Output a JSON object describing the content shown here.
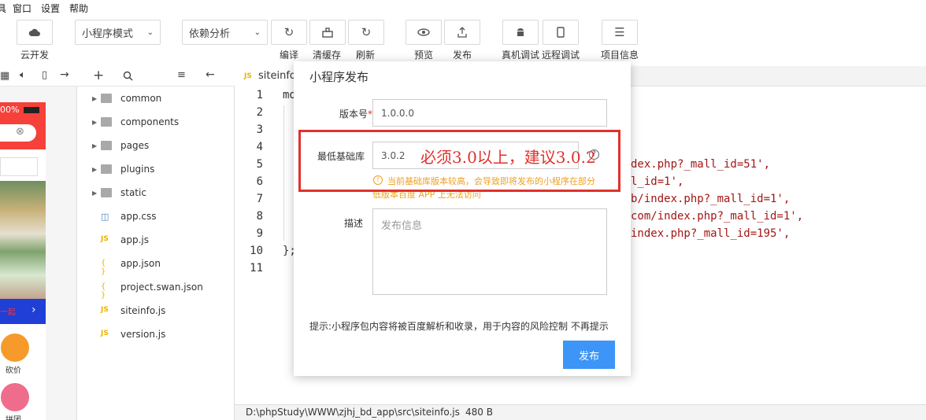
{
  "menubar": {
    "items": [
      "具",
      "窗口",
      "设置",
      "帮助"
    ]
  },
  "toolbar": {
    "cloud_label": "云开发",
    "mode_select": "小程序模式",
    "dep_select": "依赖分析",
    "compile_label": "编译",
    "clear_cache_label": "清缓存",
    "refresh_label": "刷新",
    "preview_label": "预览",
    "publish_label": "发布",
    "device_debug_label": "真机调试",
    "remote_debug_label": "远程调试",
    "project_info_label": "项目信息"
  },
  "simulator": {
    "battery_text": "00%",
    "side_labels": [
      "砍价",
      "拼团"
    ],
    "banner_text": "一起"
  },
  "file_tree": [
    {
      "name": "common",
      "type": "folder"
    },
    {
      "name": "components",
      "type": "folder"
    },
    {
      "name": "pages",
      "type": "folder"
    },
    {
      "name": "plugins",
      "type": "folder"
    },
    {
      "name": "static",
      "type": "folder"
    },
    {
      "name": "app.css",
      "type": "css"
    },
    {
      "name": "app.js",
      "type": "js"
    },
    {
      "name": "app.json",
      "type": "json"
    },
    {
      "name": "project.swan.json",
      "type": "json"
    },
    {
      "name": "siteinfo.js",
      "type": "js"
    },
    {
      "name": "version.js",
      "type": "js"
    }
  ],
  "editor": {
    "tab_title": "siteinfo.",
    "tab_icon": "JS",
    "line_numbers": [
      "1",
      "2",
      "3",
      "4",
      "5",
      "6",
      "7",
      "8",
      "9",
      "10",
      "11"
    ],
    "line1": "mo",
    "line5": "dex.php?_mall_id=51',",
    "line6": "l_id=1',",
    "line7": "b/index.php?_mall_id=1',",
    "line8": "com/index.php?_mall_id=1',",
    "line9": "index.php?_mall_id=195',",
    "line10": "};"
  },
  "statusbar": {
    "path": "D:\\phpStudy\\WWW\\zjhj_bd_app\\src\\siteinfo.js",
    "size": "480 B"
  },
  "dialog": {
    "title": "小程序发布",
    "version_label": "版本号",
    "version_required": "*",
    "version_value": "1.0.0.0",
    "min_lib_label": "最低基础库",
    "min_lib_value": "3.0.2",
    "annotation": "必须3.0以上，建议3.0.2",
    "warning_line1": "当前基础库版本较高，会导致即将发布的小程序在部分",
    "warning_line2": "低版本百度 APP 上无法访问",
    "desc_label": "描述",
    "desc_placeholder": "发布信息",
    "hint": "提示:小程序包内容将被百度解析和收录，用于内容的风险控制",
    "no_remind": "不再提示",
    "publish_button": "发布"
  },
  "colors": {
    "annotation_red": "#e0312c",
    "primary_blue": "#3c95f7",
    "warning_orange": "#f0a020"
  }
}
